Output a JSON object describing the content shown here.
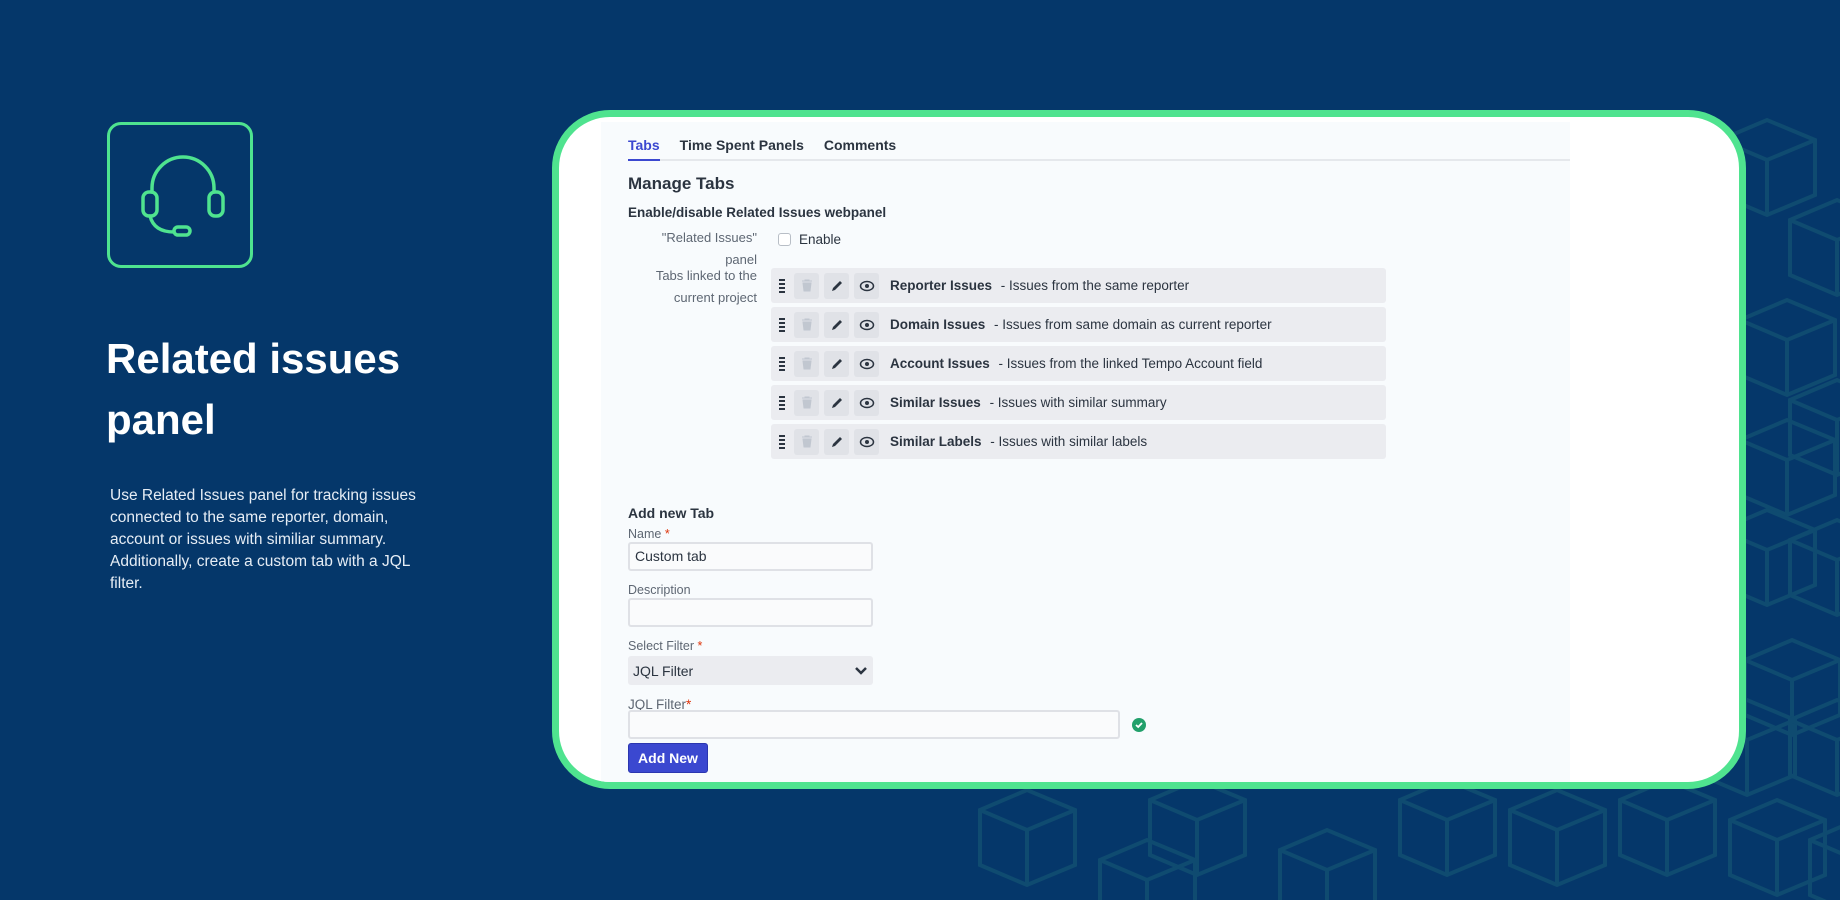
{
  "hero": {
    "title": "Related issues panel",
    "description": "Use Related Issues panel for tracking issues connected to the same reporter, domain, account or issues with similiar summary. Additionally, create a custom tab with a JQL filter.",
    "icon": "headset-icon"
  },
  "colors": {
    "background": "#05376a",
    "accent_green": "#4fe38f",
    "primary": "#3b48d0",
    "success": "#22a06b"
  },
  "tabs": [
    {
      "label": "Tabs",
      "active": true
    },
    {
      "label": "Time Spent Panels",
      "active": false
    },
    {
      "label": "Comments",
      "active": false
    }
  ],
  "manage": {
    "heading": "Manage Tabs",
    "subheading": "Enable/disable Related Issues webpanel",
    "panel_label": "\"Related Issues\" panel",
    "enable_label": "Enable",
    "enabled": false,
    "linked_label": "Tabs linked to the current project",
    "rows": [
      {
        "title": "Reporter Issues",
        "desc": " - Issues from the same reporter"
      },
      {
        "title": "Domain Issues",
        "desc": " - Issues from same domain as current reporter"
      },
      {
        "title": "Account Issues",
        "desc": " - Issues from the linked Tempo Account field"
      },
      {
        "title": "Similar Issues",
        "desc": " - Issues with similar summary"
      },
      {
        "title": "Similar Labels",
        "desc": " - Issues with similar labels"
      }
    ]
  },
  "add_tab": {
    "heading": "Add new Tab",
    "name_label": "Name",
    "name_value": "Custom tab",
    "description_label": "Description",
    "description_value": "",
    "filter_label": "Select Filter",
    "filter_value": "JQL Filter",
    "jql_label": "JQL Filter",
    "jql_value": "",
    "required_mark": "*",
    "submit_label": "Add New"
  }
}
